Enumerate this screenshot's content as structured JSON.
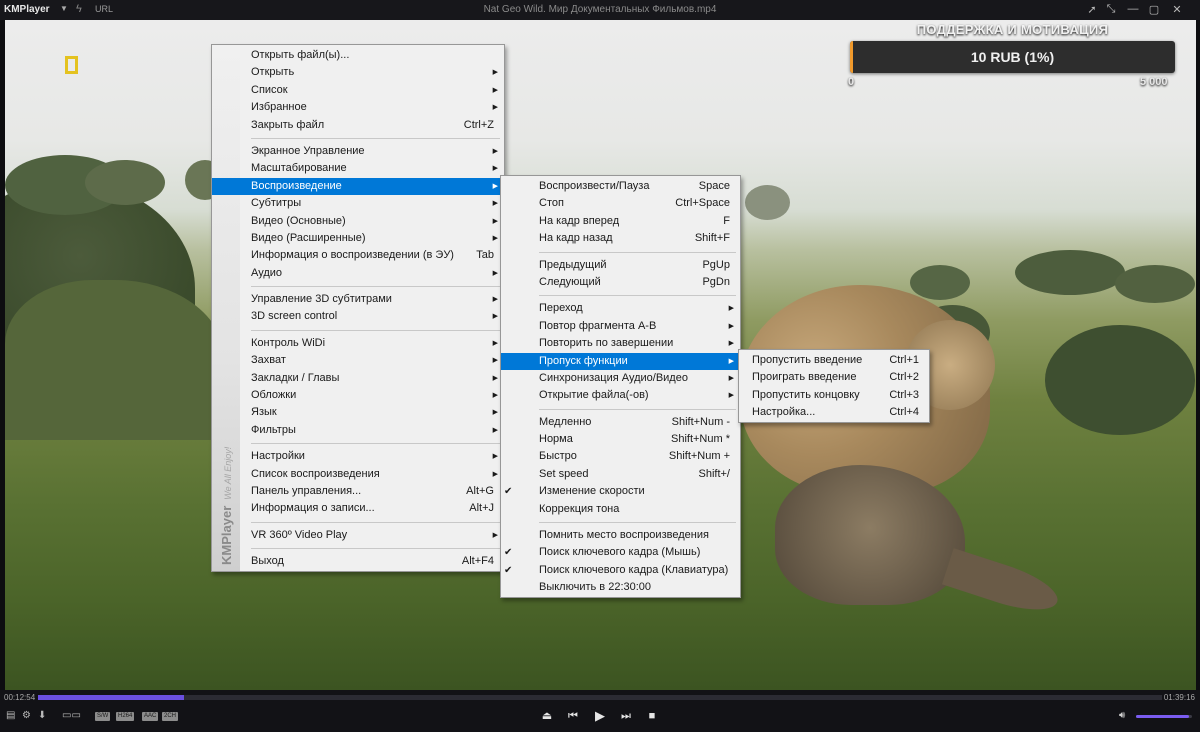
{
  "titlebar": {
    "app_name": "KMPlayer",
    "url_label": "URL",
    "window_title": "Nat Geo Wild. Мир Документальных Фильмов.mp4",
    "controls": [
      "➚",
      "⤡",
      "—",
      "▢",
      "✕"
    ]
  },
  "donation": {
    "title": "ПОДДЕРЖКА И МОТИВАЦИЯ",
    "amount": "10 RUB (1%)",
    "progress": 0.01,
    "min_label": "0",
    "max_label": "5 000",
    "accent_color": "#f19a2c"
  },
  "main_menu": {
    "brand": "KMPlayer",
    "tagline": "We All Enjoy!",
    "groups": [
      [
        {
          "label": "Открыть файл(ы)...",
          "shortcut": "",
          "submenu": false
        },
        {
          "label": "Открыть",
          "shortcut": "",
          "submenu": true
        },
        {
          "label": "Список",
          "shortcut": "",
          "submenu": true
        },
        {
          "label": "Избранное",
          "shortcut": "",
          "submenu": true
        },
        {
          "label": "Закрыть файл",
          "shortcut": "Ctrl+Z",
          "submenu": false
        }
      ],
      [
        {
          "label": "Экранное Управление",
          "shortcut": "",
          "submenu": true
        },
        {
          "label": "Масштабирование",
          "shortcut": "",
          "submenu": true
        },
        {
          "label": "Воспроизведение",
          "shortcut": "",
          "submenu": true,
          "highlighted": true
        },
        {
          "label": "Субтитры",
          "shortcut": "",
          "submenu": true
        },
        {
          "label": "Видео (Основные)",
          "shortcut": "",
          "submenu": true
        },
        {
          "label": "Видео (Расширенные)",
          "shortcut": "",
          "submenu": true
        },
        {
          "label": "Информация о воспроизведении (в ЭУ)",
          "shortcut": "Tab",
          "submenu": false
        },
        {
          "label": "Аудио",
          "shortcut": "",
          "submenu": true
        }
      ],
      [
        {
          "label": "Управление 3D субтитрами",
          "shortcut": "",
          "submenu": true
        },
        {
          "label": "3D screen control",
          "shortcut": "",
          "submenu": true
        }
      ],
      [
        {
          "label": "Контроль WiDi",
          "shortcut": "",
          "submenu": true
        },
        {
          "label": "Захват",
          "shortcut": "",
          "submenu": true
        },
        {
          "label": "Закладки / Главы",
          "shortcut": "",
          "submenu": true
        },
        {
          "label": "Обложки",
          "shortcut": "",
          "submenu": true
        },
        {
          "label": "Язык",
          "shortcut": "",
          "submenu": true
        },
        {
          "label": "Фильтры",
          "shortcut": "",
          "submenu": true
        }
      ],
      [
        {
          "label": "Настройки",
          "shortcut": "",
          "submenu": true
        },
        {
          "label": "Список воспроизведения",
          "shortcut": "",
          "submenu": true
        },
        {
          "label": "Панель управления...",
          "shortcut": "Alt+G",
          "submenu": false
        },
        {
          "label": "Информация о записи...",
          "shortcut": "Alt+J",
          "submenu": false
        }
      ],
      [
        {
          "label": "VR 360º Video Play",
          "shortcut": "",
          "submenu": true
        }
      ],
      [
        {
          "label": "Выход",
          "shortcut": "Alt+F4",
          "submenu": false
        }
      ]
    ]
  },
  "playback_menu": {
    "groups": [
      [
        {
          "label": "Воспроизвести/Пауза",
          "shortcut": "Space",
          "submenu": false
        },
        {
          "label": "Стоп",
          "shortcut": "Ctrl+Space",
          "submenu": false
        },
        {
          "label": "На кадр вперед",
          "shortcut": "F",
          "submenu": false
        },
        {
          "label": "На кадр назад",
          "shortcut": "Shift+F",
          "submenu": false
        }
      ],
      [
        {
          "label": "Предыдущий",
          "shortcut": "PgUp",
          "submenu": false
        },
        {
          "label": "Следующий",
          "shortcut": "PgDn",
          "submenu": false
        }
      ],
      [
        {
          "label": "Переход",
          "shortcut": "",
          "submenu": true
        },
        {
          "label": "Повтор фрагмента A-B",
          "shortcut": "",
          "submenu": true
        },
        {
          "label": "Повторить по завершении",
          "shortcut": "",
          "submenu": true
        },
        {
          "label": "Пропуск функции",
          "shortcut": "",
          "submenu": true,
          "highlighted": true
        },
        {
          "label": "Синхронизация Аудио/Видео",
          "shortcut": "",
          "submenu": true
        },
        {
          "label": "Открытие файла(-ов)",
          "shortcut": "",
          "submenu": true
        }
      ],
      [
        {
          "label": "Медленно",
          "shortcut": "Shift+Num -",
          "submenu": false
        },
        {
          "label": "Норма",
          "shortcut": "Shift+Num *",
          "submenu": false
        },
        {
          "label": "Быстро",
          "shortcut": "Shift+Num +",
          "submenu": false
        },
        {
          "label": "Set speed",
          "shortcut": "Shift+/",
          "submenu": false
        },
        {
          "label": "Изменение скорости",
          "shortcut": "",
          "submenu": false,
          "checked": true
        },
        {
          "label": "Коррекция тона",
          "shortcut": "",
          "submenu": false
        }
      ],
      [
        {
          "label": "Помнить место воспроизведения",
          "shortcut": "",
          "submenu": false
        },
        {
          "label": "Поиск ключевого кадра (Мышь)",
          "shortcut": "",
          "submenu": false,
          "checked": true
        },
        {
          "label": "Поиск ключевого кадра (Клавиатура)",
          "shortcut": "",
          "submenu": false,
          "checked": true
        },
        {
          "label": "Выключить в 22:30:00",
          "shortcut": "",
          "submenu": false
        }
      ]
    ]
  },
  "skip_menu": {
    "groups": [
      [
        {
          "label": "Пропустить введение",
          "shortcut": "Ctrl+1",
          "submenu": false
        },
        {
          "label": "Проиграть введение",
          "shortcut": "Ctrl+2",
          "submenu": false
        },
        {
          "label": "Пропустить концовку",
          "shortcut": "Ctrl+3",
          "submenu": false
        },
        {
          "label": "Настройка...",
          "shortcut": "Ctrl+4",
          "submenu": false
        }
      ]
    ]
  },
  "player": {
    "time_current": "00:12:54",
    "time_total": "01:39:16",
    "progress": 0.13,
    "codec_badges": [
      "S/W",
      "H264",
      "AAC",
      "2CH"
    ],
    "volume": 0.95,
    "accent_color": "#6a4fe0"
  }
}
